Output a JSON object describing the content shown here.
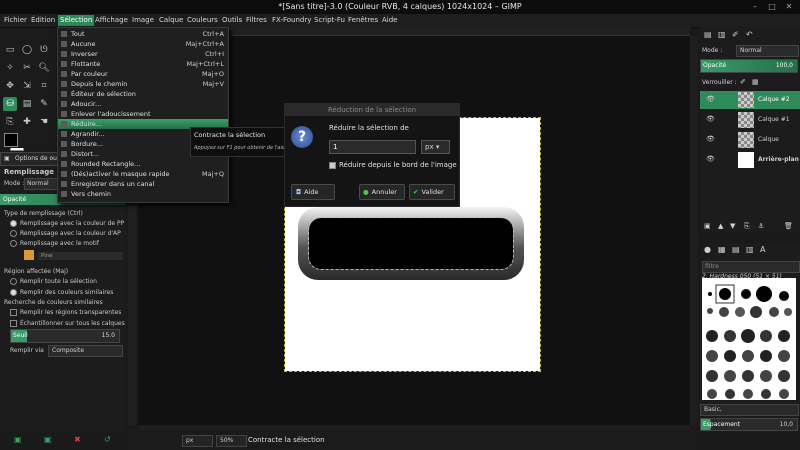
{
  "window": {
    "title": "*[Sans titre]-3.0 (Couleur RVB, 4 calques) 1024x1024 – GIMP"
  },
  "menubar": [
    "Fichier",
    "Édition",
    "Sélection",
    "Affichage",
    "Image",
    "Calque",
    "Couleurs",
    "Outils",
    "Filtres",
    "FX-Foundry",
    "Script-Fu",
    "Fenêtres",
    "Aide"
  ],
  "selection_menu": {
    "items": [
      {
        "label": "Tout",
        "shortcut": "Ctrl+A"
      },
      {
        "label": "Aucune",
        "shortcut": "Maj+Ctrl+A"
      },
      {
        "label": "Inverser",
        "shortcut": "Ctrl+I"
      },
      {
        "label": "Flottante",
        "shortcut": "Maj+Ctrl+L"
      },
      {
        "label": "Par couleur",
        "shortcut": "Maj+O"
      },
      {
        "label": "Depuis le chemin",
        "shortcut": "Maj+V"
      },
      {
        "label": "Éditeur de sélection",
        "shortcut": ""
      },
      {
        "label": "Adoucir...",
        "shortcut": ""
      },
      {
        "label": "Enlever l'adoucissement",
        "shortcut": ""
      },
      {
        "label": "Réduire...",
        "shortcut": ""
      },
      {
        "label": "Agrandir...",
        "shortcut": ""
      },
      {
        "label": "Bordure...",
        "shortcut": ""
      },
      {
        "label": "Distort...",
        "shortcut": ""
      },
      {
        "label": "Rounded Rectangle...",
        "shortcut": ""
      },
      {
        "label": "(Dés)activer le masque rapide",
        "shortcut": "Maj+Q"
      },
      {
        "label": "Enregistrer dans un canal",
        "shortcut": ""
      },
      {
        "label": "Vers chemin",
        "shortcut": ""
      }
    ]
  },
  "tooltip": {
    "title": "Contracte la sélection",
    "hint": "Appuyez sur F1 pour obtenir de l'aide"
  },
  "dialog": {
    "title": "Réduction de la sélection",
    "label": "Réduire la sélection de",
    "value": "1",
    "unit": "px",
    "checkbox": "Réduire depuis le bord de l'image",
    "help": "Aide",
    "cancel": "Annuler",
    "ok": "Valider"
  },
  "tool_options": {
    "tab": "Options de ou",
    "title": "Remplissage",
    "mode_label": "Mode :",
    "mode_value": "Normal",
    "opacity_label": "Opacité",
    "fill_type_label": "Type de remplissage  (Ctrl)",
    "fill_types": [
      "Remplissage avec la couleur de PP",
      "Remplissage avec la couleur d'AP",
      "Remplissage avec le motif"
    ],
    "pattern_name": "Pine",
    "region_label": "Région affectée  (Maj)",
    "regions": [
      "Remplir toute la sélection",
      "Remplir des couleurs similaires"
    ],
    "similar_label": "Recherche de couleurs similaires",
    "check1": "Remplir les régions transparentes",
    "check2": "Échantillonner sur tous les calques",
    "seuil_label": "Seuil",
    "seuil_value": "15.0",
    "remplir_label": "Remplir via",
    "remplir_value": "Composite"
  },
  "statusbar": {
    "unit": "px",
    "zoom": "50%",
    "message": "Contracte la sélection"
  },
  "layers_panel": {
    "mode_label": "Mode :",
    "mode_value": "Normal",
    "opacity_label": "Opacité",
    "opacity_value": "100,0",
    "lock_label": "Verrouiller :",
    "layers": [
      "Calque #2",
      "Calque #1",
      "Calque",
      "Arrière-plan"
    ]
  },
  "brushes_panel": {
    "filter_placeholder": "filtre",
    "brush_name": "2. Hardness 050 (51 × 51)",
    "preset": "Basic,",
    "spacing_label": "Espacement",
    "spacing_value": "10,0"
  }
}
